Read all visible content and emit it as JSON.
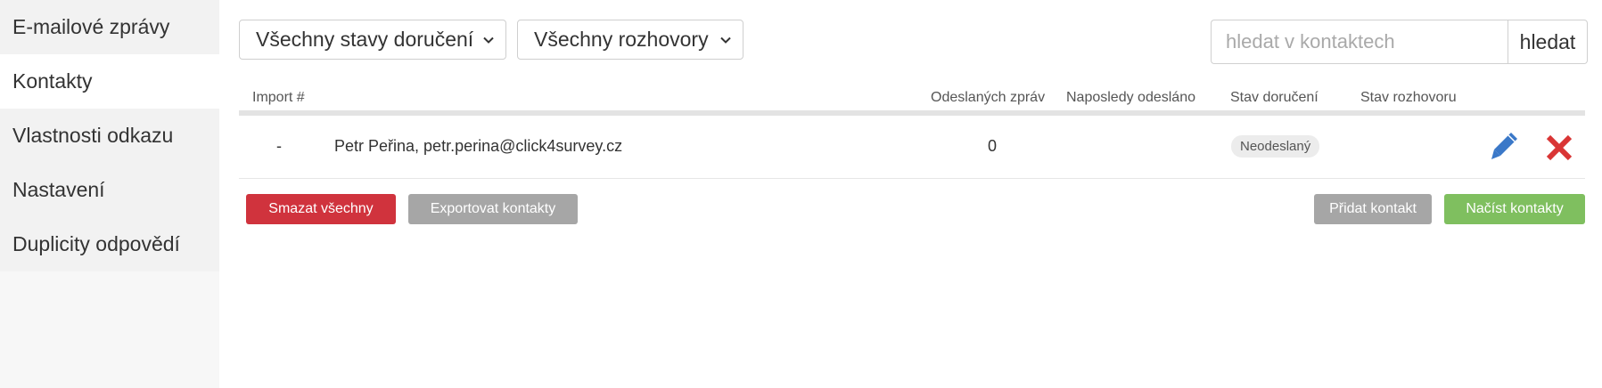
{
  "sidebar": {
    "items": [
      {
        "label": "E-mailové zprávy"
      },
      {
        "label": "Kontakty"
      },
      {
        "label": "Vlastnosti odkazu"
      },
      {
        "label": "Nastavení"
      },
      {
        "label": "Duplicity odpovědí"
      }
    ],
    "active_index": 1
  },
  "filters": {
    "delivery_status": "Všechny stavy doručení",
    "conversations": "Všechny rozhovory"
  },
  "search": {
    "placeholder": "hledat v kontaktech",
    "value": "",
    "button_label": "hledat"
  },
  "table": {
    "headers": {
      "import": "Import #",
      "sent": "Odeslaných zpráv",
      "last_sent": "Naposledy odesláno",
      "delivery": "Stav doručení",
      "conversation": "Stav rozhovoru"
    },
    "rows": [
      {
        "import": "-",
        "contact": "Petr Peřina, petr.perina@click4survey.cz",
        "sent": "0",
        "last_sent": "",
        "delivery": "Neodeslaný",
        "conversation": ""
      }
    ]
  },
  "buttons": {
    "delete_all": "Smazat všechny",
    "export": "Exportovat kontakty",
    "add": "Přidat kontakt",
    "load": "Načíst kontakty"
  },
  "icons": {
    "edit": "pencil-icon",
    "delete": "close-icon",
    "dropdown": "chevron-down-icon"
  },
  "colors": {
    "danger": "#d0333d",
    "neutral": "#a6a6a6",
    "success": "#7fbf5f",
    "edit_icon": "#3a78c8",
    "delete_icon": "#d93535"
  }
}
